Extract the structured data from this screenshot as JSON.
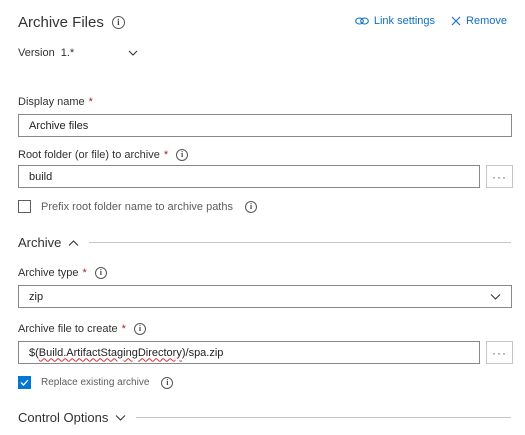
{
  "header": {
    "title": "Archive Files",
    "link_settings": "Link settings",
    "remove": "Remove"
  },
  "version": {
    "label": "Version",
    "value": "1.*"
  },
  "display_name": {
    "label": "Display name",
    "required": "*",
    "value": "Archive files"
  },
  "root_folder": {
    "label": "Root folder (or file) to archive",
    "required": "*",
    "value": "build",
    "browse": "···"
  },
  "prefix_root": {
    "label": "Prefix root folder name to archive paths",
    "checked": false
  },
  "archive_section": {
    "title": "Archive"
  },
  "archive_type": {
    "label": "Archive type",
    "required": "*",
    "value": "zip"
  },
  "archive_file": {
    "label": "Archive file to create",
    "required": "*",
    "value_prefix": "$(",
    "value_var": "Build.ArtifactStagingDirectory",
    "value_suffix": ")/spa.zip",
    "browse": "···"
  },
  "replace_existing": {
    "label": "Replace existing archive",
    "checked": true
  },
  "control_section": {
    "title": "Control Options"
  },
  "colors": {
    "accent": "#0078d4",
    "link": "#106ebe",
    "required": "#a4262c"
  },
  "icons": [
    "info-icon",
    "link-icon",
    "close-icon",
    "chevron-down-icon",
    "chevron-up-icon",
    "checkmark-icon"
  ]
}
